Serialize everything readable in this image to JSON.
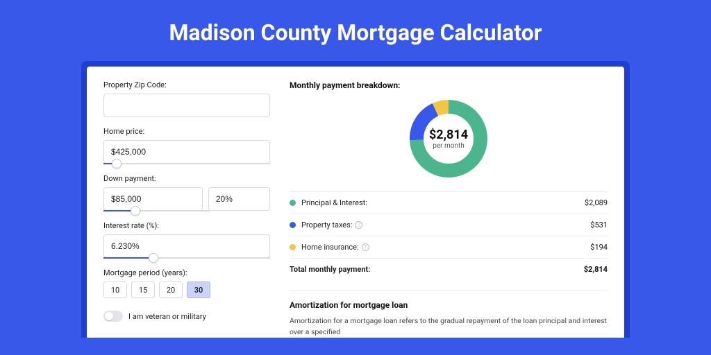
{
  "title": "Madison County Mortgage Calculator",
  "form": {
    "zip": {
      "label": "Property Zip Code:",
      "value": ""
    },
    "home_price": {
      "label": "Home price:",
      "value": "$425,000",
      "slider_pct": 8
    },
    "down_payment": {
      "label": "Down payment:",
      "value": "$85,000",
      "pct_value": "20%",
      "slider_pct": 20
    },
    "interest_rate": {
      "label": "Interest rate (%):",
      "value": "6.230%",
      "slider_pct": 30
    },
    "period": {
      "label": "Mortgage period (years):",
      "options": [
        "10",
        "15",
        "20",
        "30"
      ],
      "selected": "30"
    },
    "veteran": {
      "label": "I am veteran or military",
      "checked": false
    }
  },
  "breakdown": {
    "title": "Monthly payment breakdown:",
    "center_amount": "$2,814",
    "center_sub": "per month",
    "items": [
      {
        "label": "Principal & Interest:",
        "amount": "$2,089",
        "color": "#4bb58e",
        "info": false
      },
      {
        "label": "Property taxes:",
        "amount": "$531",
        "color": "#3858e9",
        "info": true
      },
      {
        "label": "Home insurance:",
        "amount": "$194",
        "color": "#f4c542",
        "info": true
      }
    ],
    "total_label": "Total monthly payment:",
    "total_amount": "$2,814"
  },
  "chart_data": {
    "type": "pie",
    "title": "Monthly payment breakdown",
    "series": [
      {
        "name": "Principal & Interest",
        "value": 2089,
        "color": "#4bb58e"
      },
      {
        "name": "Property taxes",
        "value": 531,
        "color": "#3858e9"
      },
      {
        "name": "Home insurance",
        "value": 194,
        "color": "#f4c542"
      }
    ],
    "total": 2814
  },
  "amortization": {
    "title": "Amortization for mortgage loan",
    "text": "Amortization for a mortgage loan refers to the gradual repayment of the loan principal and interest over a specified"
  },
  "colors": {
    "accent": "#3858e9"
  }
}
